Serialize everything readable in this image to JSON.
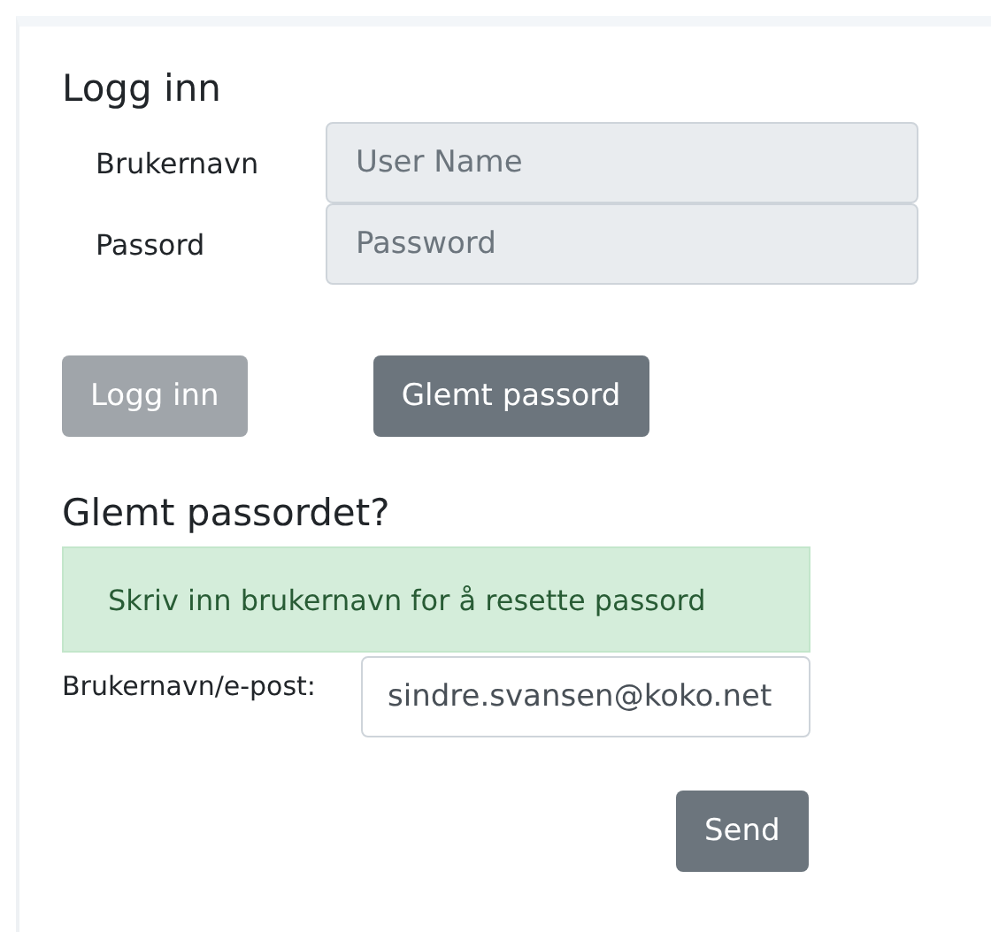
{
  "login": {
    "title": "Logg inn",
    "fields": [
      {
        "label": "Brukernavn",
        "placeholder": "User Name",
        "disabled": true
      },
      {
        "label": "Passord",
        "placeholder": "Password",
        "disabled": true
      }
    ],
    "buttons": [
      {
        "label": "Logg inn",
        "disabled": true
      },
      {
        "label": "Glemt passord",
        "disabled": false
      }
    ]
  },
  "forgot": {
    "title": "Glemt passordet?",
    "alert": "Skriv inn brukernavn for å resette passord",
    "field": {
      "label": "Brukernavn/e-post:",
      "value": "sindre.svansen@koko.net",
      "disabled": false
    },
    "button": {
      "label": "Send",
      "disabled": false
    }
  }
}
